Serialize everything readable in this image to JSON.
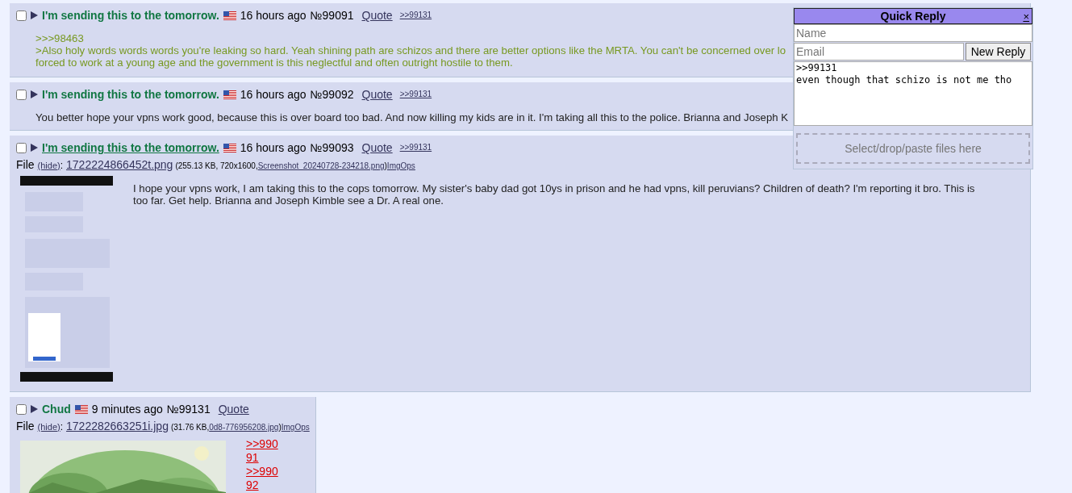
{
  "posts": [
    {
      "name": "I'm sending this to the tomorrow.",
      "name_link": false,
      "time": "16 hours ago",
      "number": "№99091",
      "quote": "Quote",
      "backlinks": [
        ">>99131"
      ],
      "checked": false,
      "body": [
        {
          "kind": "greentext",
          "text": ">>>98463"
        },
        {
          "kind": "greentext",
          "text": ">Also holy words words words you're leaking so hard. Yeah shining path are schizos and there are better options like the MRTA. You can't be concerned over lo"
        },
        {
          "kind": "greentext",
          "text": "forced to work at a young age and the government is this neglectful and often outright hostile to them."
        }
      ]
    },
    {
      "name": "I'm sending this to the tomorrow.",
      "name_link": false,
      "time": "16 hours ago",
      "number": "№99092",
      "quote": "Quote",
      "backlinks": [
        ">>99131"
      ],
      "checked": false,
      "body": [
        {
          "kind": "plain",
          "text": "You better hope your vpns work good, because this is over board too bad. And now killing my kids are in it. I'm taking all this to the police. Brianna and Joseph K"
        }
      ]
    },
    {
      "name": "I'm sending this to the tomorrow.",
      "name_link": true,
      "time": "16 hours ago",
      "number": "№99093",
      "quote": "Quote",
      "backlinks": [
        ">>99131"
      ],
      "checked": false,
      "file": {
        "label": "File",
        "hide": "(hide)",
        "colon": ":",
        "filename": "1722224866452t.png",
        "meta": "(255.13 KB, 720x1600, ",
        "original": "Screenshot_20240728-234218.png",
        "close": ")",
        "imgops": "ImgOps"
      },
      "body": [
        {
          "kind": "plain",
          "text": "I hope your vpns work, I am taking this to the cops tomorrow. My sister's baby dad got 10ys in prison and he had vpns, kill peruvians? Children of death?  I'm reporting it bro. This is"
        },
        {
          "kind": "plain",
          "text": "too far. Get help. Brianna and Joseph Kimble see a Dr. A real one."
        }
      ]
    },
    {
      "name": "Chud",
      "name_link": false,
      "time": "9 minutes ago",
      "number": "№99131",
      "quote": "Quote",
      "checked": false,
      "file": {
        "label": "File",
        "hide": "(hide)",
        "colon": ":",
        "filename": "1722282663251i.jpg",
        "meta": "(31.76 KB, ",
        "original": "0d8-776956208.jpg",
        "close": ")",
        "imgops": "ImgOps"
      },
      "replies": [
        ">>99091",
        ">>99092"
      ]
    }
  ],
  "quick_reply": {
    "title": "Quick Reply",
    "close": "×",
    "name_placeholder": "Name",
    "email_placeholder": "Email",
    "submit": "New Reply",
    "message": ">>99131\neven though that schizo is not me tho",
    "files": "Select/drop/paste files here"
  }
}
